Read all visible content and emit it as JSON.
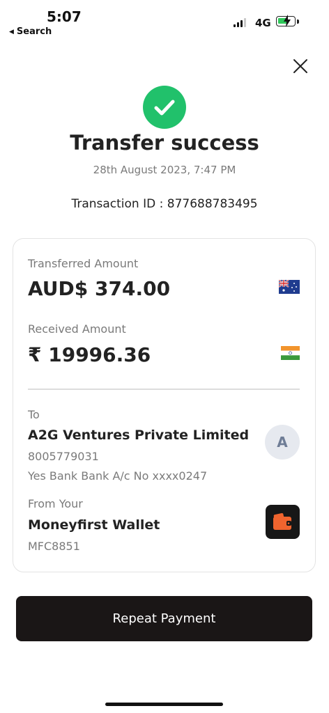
{
  "status_bar": {
    "time": "5:07",
    "back_label": "Search",
    "network": "4G"
  },
  "header": {
    "title": "Transfer success",
    "date": "28th August  2023, 7:47 PM",
    "transaction_id": "Transaction ID : 877688783495"
  },
  "card": {
    "transferred": {
      "label": "Transferred Amount",
      "amount": "AUD$ 374.00",
      "flag": "australia-flag-icon"
    },
    "received": {
      "label": "Received Amount",
      "amount": "₹ 19996.36",
      "flag": "india-flag-icon"
    },
    "to": {
      "label": "To",
      "name": "A2G Ventures Private Limited",
      "phone": "8005779031",
      "bank": "Yes Bank Bank A/c No xxxx0247",
      "avatar_letter": "A"
    },
    "from": {
      "label": "From Your",
      "name": "Moneyfirst Wallet",
      "code": "MFC8851",
      "icon": "wallet-icon"
    }
  },
  "actions": {
    "repeat_label": "Repeat Payment"
  },
  "colors": {
    "success": "#21c16b",
    "button": "#1a1616",
    "wallet_icon": "#f0642e"
  }
}
